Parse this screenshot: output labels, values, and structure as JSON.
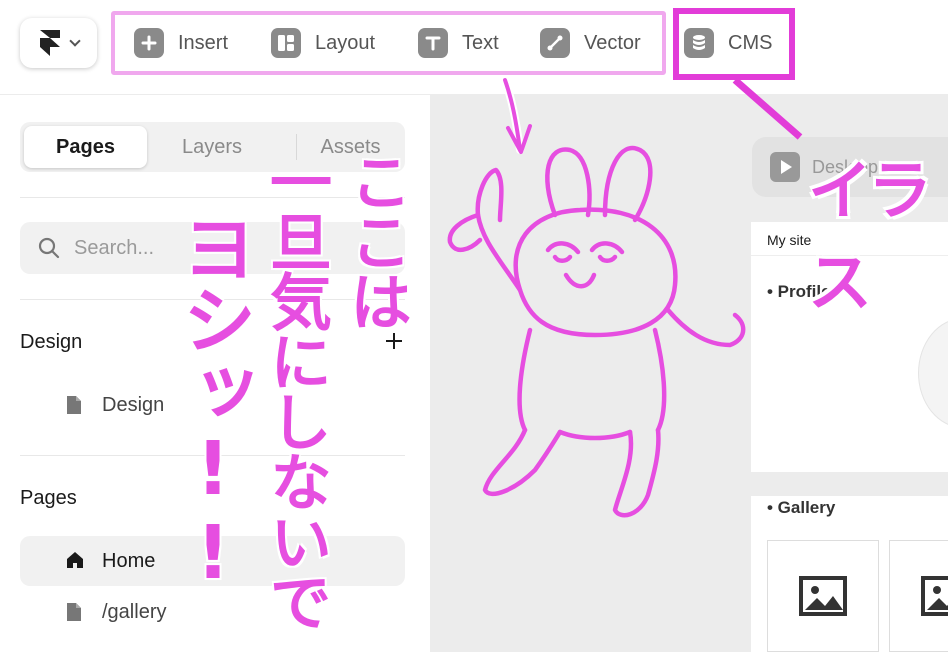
{
  "toolbar": {
    "tools": [
      {
        "label": "Insert",
        "icon": "plus-icon"
      },
      {
        "label": "Layout",
        "icon": "layout-icon"
      },
      {
        "label": "Text",
        "icon": "text-icon"
      },
      {
        "label": "Vector",
        "icon": "vector-pen-icon"
      }
    ],
    "cms_label": "CMS"
  },
  "sidebar": {
    "tabs": [
      "Pages",
      "Layers",
      "Assets"
    ],
    "active_tab": "Pages",
    "search_placeholder": "Search...",
    "sections": [
      {
        "title": "Design",
        "items": [
          {
            "label": "Design",
            "icon": "file-icon"
          }
        ]
      },
      {
        "title": "Pages",
        "items": [
          {
            "label": "Home",
            "icon": "home-icon",
            "active": true
          },
          {
            "label": "/gallery",
            "icon": "file-icon",
            "active": false
          }
        ]
      }
    ]
  },
  "canvas": {
    "preview_label": "Desktop",
    "site_name": "My site",
    "sections": [
      "• Profile",
      "• Gallery"
    ]
  },
  "annotations": {
    "vertical_1": "ここは",
    "vertical_2": "一旦気にしないで",
    "vertical_3": "ヨシッ!!",
    "top_right": "イラス",
    "color": "#e64ee0"
  }
}
